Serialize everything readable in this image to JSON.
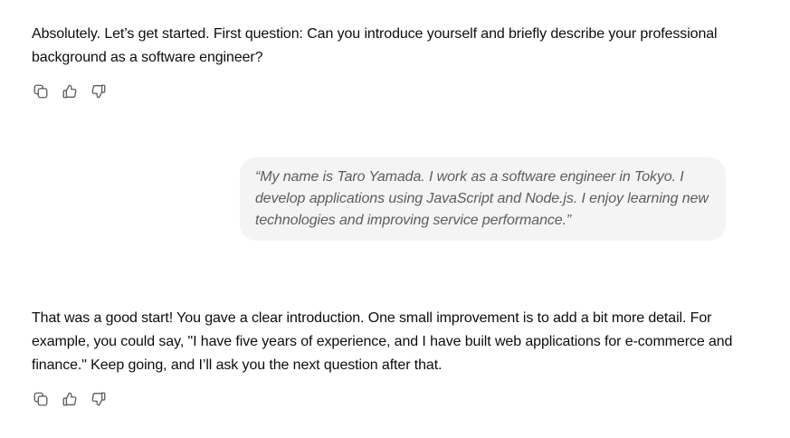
{
  "conversation": {
    "assistant_message_1": "Absolutely. Let’s get started. First question: Can you introduce yourself and briefly describe your professional background as a software engineer?",
    "user_message_1": "“My name is Taro Yamada. I work as a software engineer in Tokyo. I develop applications using JavaScript and Node.js. I enjoy learning new technologies and improving service performance.”",
    "assistant_message_2": "That was a good start! You gave a clear introduction. One small improvement is to add a bit more detail. For example, you could say, \"I have five years of experience, and I have built web applications for e-commerce and finance.\" Keep going, and I’ll ask you the next question after that."
  },
  "action_icons": [
    "copy-icon",
    "thumbs-up-icon",
    "thumbs-down-icon"
  ],
  "colors": {
    "text": "#0d0d0d",
    "icon": "#5d5d5d",
    "bubble_bg": "#f4f4f4",
    "bubble_text": "#5d5d5d"
  }
}
